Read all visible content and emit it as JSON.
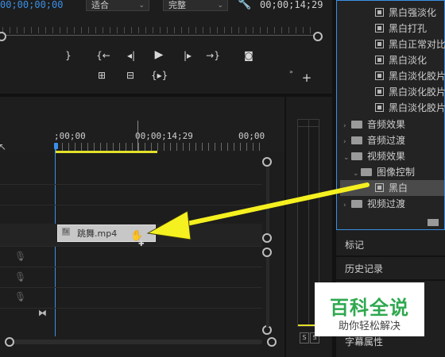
{
  "program_monitor": {
    "timecode_current": "00;00;00;00",
    "fit_select": "适合",
    "quality_select": "完整",
    "timecode_duration": "00;00;14;29"
  },
  "timeline": {
    "ruler_labels": [
      ";00;00",
      "00;00;14;29",
      "00;00"
    ],
    "clip_name": "跳舞.mp4",
    "clip_badge": "fx"
  },
  "effects_panel": {
    "video_effects_items": [
      "黑白强淡化",
      "黑白打孔",
      "黑白正常对比",
      "黑白淡化",
      "黑白淡化胶片",
      "黑白淡化胶片",
      "黑白淡化胶片"
    ],
    "folders": [
      {
        "label": "音频效果",
        "expanded": false
      },
      {
        "label": "音频过渡",
        "expanded": false
      },
      {
        "label": "视频效果",
        "expanded": true
      }
    ],
    "subfolder": "图像控制",
    "selected_effect": "黑白",
    "video_transitions": "视频过渡"
  },
  "side_panels": {
    "markers": "标记",
    "history": "历史记录",
    "caption_props": "字幕属性"
  },
  "meter": {
    "solo_labels": [
      "S",
      "S"
    ]
  },
  "watermark": {
    "title": "百科全说",
    "subtitle": "助你轻松解决"
  },
  "colors": {
    "accent_blue": "#3b8fe6",
    "arrow_yellow": "#f5f01f",
    "watermark_green": "#2fa84f"
  }
}
